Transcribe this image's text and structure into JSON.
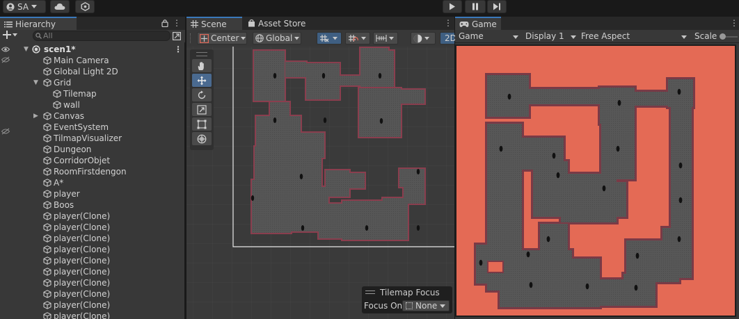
{
  "toolbar": {
    "account_label": "SA",
    "icons": [
      "user-icon",
      "cloud-icon",
      "collab-icon",
      "play-icon",
      "pause-icon",
      "step-icon"
    ]
  },
  "hierarchy": {
    "tab_label": "Hierarchy",
    "search_placeholder": "All",
    "scene_name": "scen1*",
    "items": [
      {
        "label": "Main Camera"
      },
      {
        "label": "Global Light 2D"
      },
      {
        "label": "Grid"
      },
      {
        "label": "Tilemap"
      },
      {
        "label": "wall"
      },
      {
        "label": "Canvas"
      },
      {
        "label": "EventSystem"
      },
      {
        "label": "TilmapVisualizer"
      },
      {
        "label": "Dungeon"
      },
      {
        "label": "CorridorObjet"
      },
      {
        "label": "RoomFirstdengon"
      },
      {
        "label": "A*"
      },
      {
        "label": "player"
      },
      {
        "label": "Boos"
      },
      {
        "label": "player(Clone)"
      },
      {
        "label": "player(Clone)"
      },
      {
        "label": "player(Clone)"
      },
      {
        "label": "player(Clone)"
      },
      {
        "label": "player(Clone)"
      },
      {
        "label": "player(Clone)"
      },
      {
        "label": "player(Clone)"
      },
      {
        "label": "player(Clone)"
      },
      {
        "label": "player(Clone)"
      },
      {
        "label": "player(Clone)"
      }
    ]
  },
  "scene": {
    "tabs": [
      {
        "label": "Scene"
      },
      {
        "label": "Asset Store"
      }
    ],
    "pivot_label": "Center",
    "space_label": "Global",
    "mode_2d_label": "2D",
    "tilemap_focus": {
      "title": "Tilemap Focus",
      "focus_on_label": "Focus On",
      "focus_value": "None"
    }
  },
  "game": {
    "tab_label": "Game",
    "view_dropdown": "Game",
    "display_dropdown": "Display 1",
    "aspect_dropdown": "Free Aspect",
    "scale_label": "Scale",
    "background_color": "#e46a55"
  }
}
